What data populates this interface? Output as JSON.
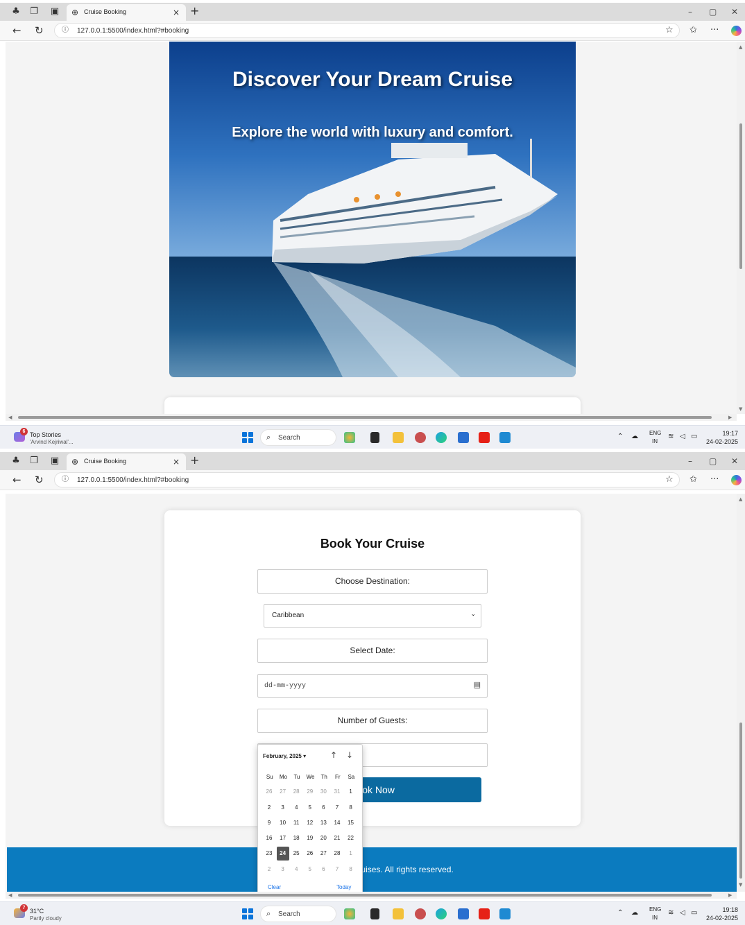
{
  "browser": {
    "tab_title": "Cruise Booking",
    "tab_close": "×",
    "new_tab": "+",
    "url": "127.0.0.1:5500/index.html?#booking",
    "back": "←",
    "reload": "↻",
    "minimize": "–",
    "restore": "▢",
    "close": "✕",
    "more": "···"
  },
  "hero": {
    "title": "Discover Your Dream Cruise",
    "subtitle": "Explore the world with luxury and comfort."
  },
  "booking": {
    "title": "Book Your Cruise",
    "destination_label": "Choose Destination:",
    "destination_value": "Caribbean",
    "date_label": "Select Date:",
    "date_placeholder": "dd-mm-yyyy",
    "guests_label": "Number of Guests:",
    "button": "Book Now"
  },
  "datepicker": {
    "month": "February, 2025 ▾",
    "weekdays": [
      "Su",
      "Mo",
      "Tu",
      "We",
      "Th",
      "Fr",
      "Sa"
    ],
    "weeks": [
      [
        "26",
        "27",
        "28",
        "29",
        "30",
        "31",
        "1"
      ],
      [
        "2",
        "3",
        "4",
        "5",
        "6",
        "7",
        "8"
      ],
      [
        "9",
        "10",
        "11",
        "12",
        "13",
        "14",
        "15"
      ],
      [
        "16",
        "17",
        "18",
        "19",
        "20",
        "21",
        "22"
      ],
      [
        "23",
        "24",
        "25",
        "26",
        "27",
        "28",
        "1"
      ],
      [
        "2",
        "3",
        "4",
        "5",
        "6",
        "7",
        "8"
      ]
    ],
    "selected": "24",
    "clear": "Clear",
    "today": "Today"
  },
  "footer": {
    "text": "© 2025 Oceanic Cruises. All rights reserved."
  },
  "taskbar1": {
    "badge": "6",
    "widget_line1": "Top Stories",
    "widget_line2": "'Arvind Kejriwal'...",
    "search": "Search",
    "lang1": "ENG",
    "lang2": "IN",
    "time": "19:17",
    "date": "24-02-2025"
  },
  "taskbar2": {
    "badge": "7",
    "widget_line1": "31°C",
    "widget_line2": "Partly cloudy",
    "search": "Search",
    "lang1": "ENG",
    "lang2": "IN",
    "time": "19:18",
    "date": "24-02-2025"
  },
  "colors": {
    "primary_button": "#0b6aa0",
    "footer": "#0b7bbf",
    "selected_day": "#555555",
    "link": "#1a73e8"
  }
}
